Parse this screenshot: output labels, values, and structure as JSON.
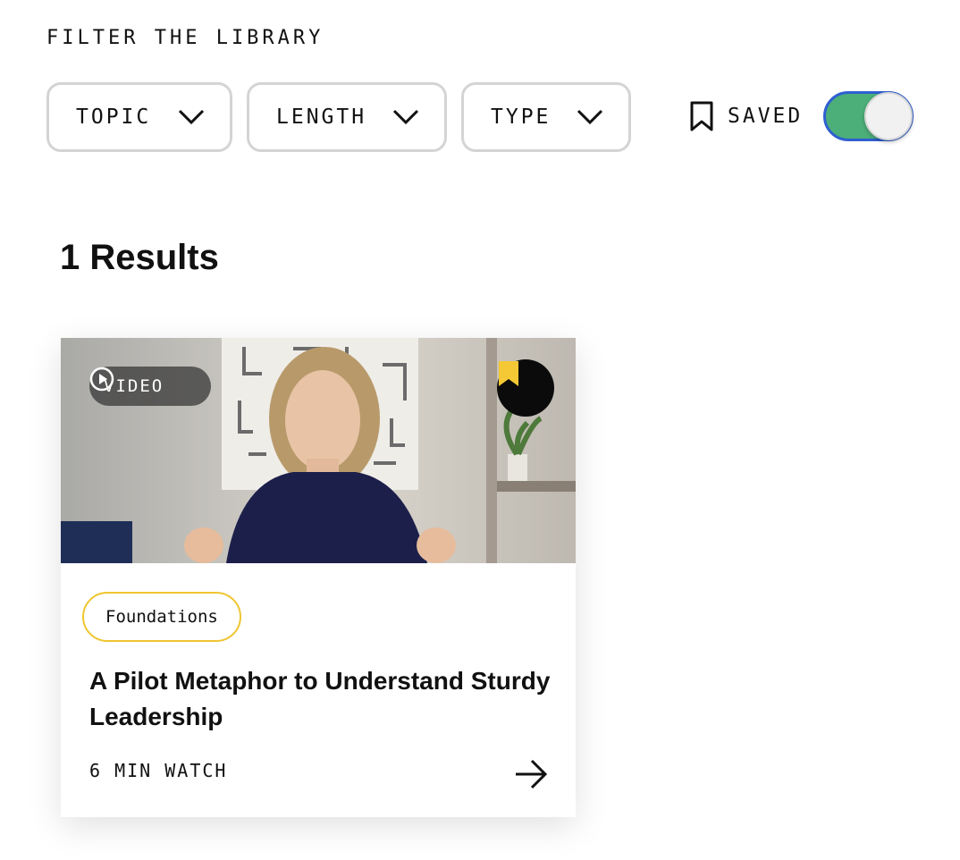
{
  "filters": {
    "heading": "FILTER THE LIBRARY",
    "topic_label": "TOPIC",
    "length_label": "LENGTH",
    "type_label": "TYPE",
    "saved_label": "SAVED",
    "saved_toggle_on": true,
    "icons": {
      "dropdown": "chevron-down-icon",
      "saved": "bookmark-outline-icon"
    }
  },
  "results": {
    "count_text": "1 Results"
  },
  "card": {
    "media_badge": "VIDEO",
    "media_icon": "play-circle-icon",
    "bookmark_icon": "bookmark-filled-icon",
    "tag": "Foundations",
    "title": "A Pilot Metaphor to Understand Sturdy Leadership",
    "duration": "6 MIN WATCH",
    "arrow_icon": "arrow-right-icon"
  },
  "colors": {
    "toggle_on": "#4caf79",
    "toggle_border": "#2f5fd0",
    "tag_border": "#f0c531",
    "bookmark_fill": "#f5c935"
  }
}
